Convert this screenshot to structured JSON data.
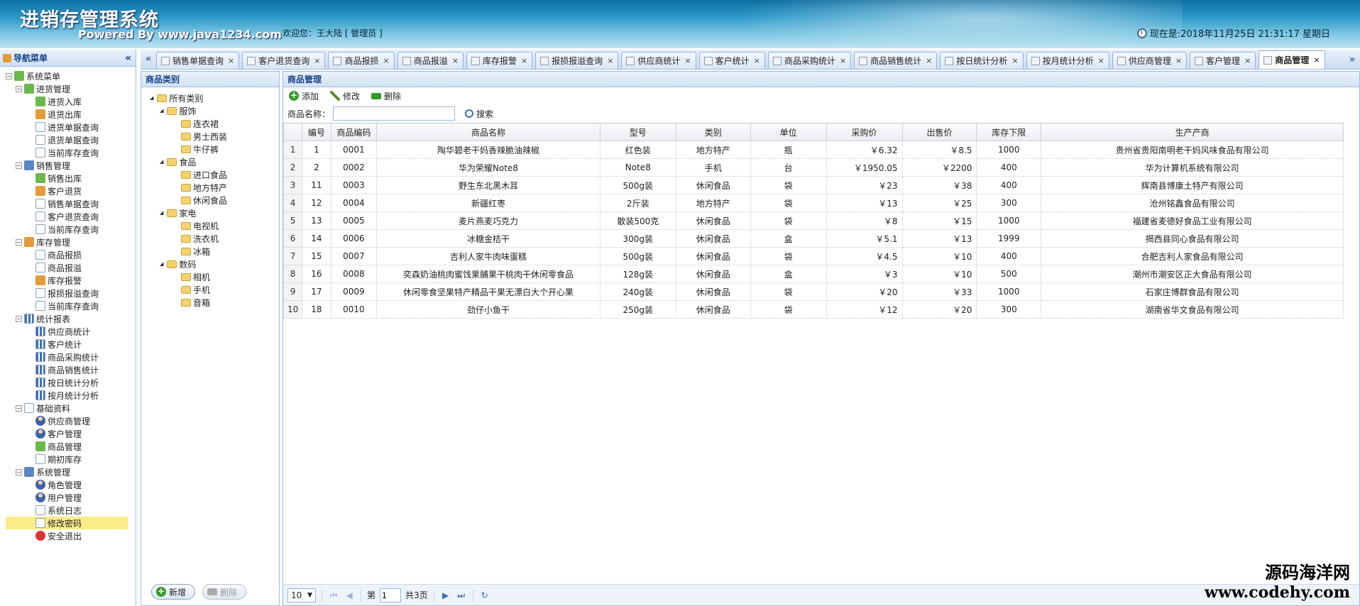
{
  "header": {
    "title": "进销存管理系统",
    "subtitle": "Powered By www.java1234.com",
    "welcome": "欢迎您：王大陆 [ 管理员 ]",
    "clock": "现在是:2018年11月25日 21:31:17 星期日"
  },
  "nav": {
    "title": "导航菜单",
    "root": "系统菜单",
    "groups": [
      {
        "label": "进货管理",
        "items": [
          "进货入库",
          "退货出库",
          "进货单据查询",
          "退货单据查询",
          "当前库存查询"
        ]
      },
      {
        "label": "销售管理",
        "items": [
          "销售出库",
          "客户退货",
          "销售单据查询",
          "客户退货查询",
          "当前库存查询"
        ]
      },
      {
        "label": "库存管理",
        "items": [
          "商品报损",
          "商品报溢",
          "库存报警",
          "报损报溢查询",
          "当前库存查询"
        ]
      },
      {
        "label": "统计报表",
        "items": [
          "供应商统计",
          "客户统计",
          "商品采购统计",
          "商品销售统计",
          "按日统计分析",
          "按月统计分析"
        ]
      },
      {
        "label": "基础资料",
        "items": [
          "供应商管理",
          "客户管理",
          "商品管理",
          "期初库存"
        ]
      },
      {
        "label": "系统管理",
        "items": [
          "角色管理",
          "用户管理",
          "系统日志",
          "修改密码",
          "安全退出"
        ]
      }
    ]
  },
  "tabs": [
    "销售单据查询",
    "客户退货查询",
    "商品报损",
    "商品报溢",
    "库存报警",
    "报损报溢查询",
    "供应商统计",
    "客户统计",
    "商品采购统计",
    "商品销售统计",
    "按日统计分析",
    "按月统计分析",
    "供应商管理",
    "客户管理",
    "商品管理"
  ],
  "category": {
    "title": "商品类别",
    "root": "所有类别",
    "groups": [
      {
        "label": "服饰",
        "items": [
          "连衣裙",
          "男士西装",
          "牛仔裤"
        ]
      },
      {
        "label": "食品",
        "items": [
          "进口食品",
          "地方特产",
          "休闲食品"
        ]
      },
      {
        "label": "家电",
        "items": [
          "电视机",
          "洗衣机",
          "冰箱"
        ]
      },
      {
        "label": "数码",
        "items": [
          "相机",
          "手机",
          "音箱"
        ]
      }
    ],
    "add_label": "新增",
    "delete_label": "删除"
  },
  "main": {
    "title": "商品管理",
    "toolbar": {
      "add": "添加",
      "edit": "修改",
      "delete": "删除"
    },
    "search": {
      "label": "商品名称：",
      "value": "",
      "button": "搜索"
    },
    "columns": [
      "",
      "编号",
      "商品编码",
      "商品名称",
      "型号",
      "类别",
      "单位",
      "采购价",
      "出售价",
      "库存下限",
      "生产产商"
    ],
    "rows": [
      [
        "1",
        "1",
        "0001",
        "陶华碧老干妈香辣脆油辣椒",
        "红色装",
        "地方特产",
        "瓶",
        "￥6.32",
        "￥8.5",
        "1000",
        "贵州省贵阳南明老干妈风味食品有限公司"
      ],
      [
        "2",
        "2",
        "0002",
        "华为荣耀Note8",
        "Note8",
        "手机",
        "台",
        "￥1950.05",
        "￥2200",
        "400",
        "华为计算机系统有限公司"
      ],
      [
        "3",
        "11",
        "0003",
        "野生东北黑木耳",
        "500g装",
        "休闲食品",
        "袋",
        "￥23",
        "￥38",
        "400",
        "辉南县博康土特产有限公司"
      ],
      [
        "4",
        "12",
        "0004",
        "新疆红枣",
        "2斤装",
        "地方特产",
        "袋",
        "￥13",
        "￥25",
        "300",
        "沧州铭鑫食品有限公司"
      ],
      [
        "5",
        "13",
        "0005",
        "麦片燕麦巧克力",
        "散装500克",
        "休闲食品",
        "袋",
        "￥8",
        "￥15",
        "1000",
        "福建省麦德好食品工业有限公司"
      ],
      [
        "6",
        "14",
        "0006",
        "冰糖金桔干",
        "300g装",
        "休闲食品",
        "盒",
        "￥5.1",
        "￥13",
        "1999",
        "揭西县同心食品有限公司"
      ],
      [
        "7",
        "15",
        "0007",
        "吉利人家牛肉味蛋糕",
        "500g装",
        "休闲食品",
        "袋",
        "￥4.5",
        "￥10",
        "400",
        "合肥吉利人家食品有限公司"
      ],
      [
        "8",
        "16",
        "0008",
        "奕森奶油桃肉蜜饯果脯果干桃肉干休闲零食品",
        "128g装",
        "休闲食品",
        "盒",
        "￥3",
        "￥10",
        "500",
        "潮州市潮安区正大食品有限公司"
      ],
      [
        "9",
        "17",
        "0009",
        "休闲零食坚果特产精品干果无漂白大个开心果",
        "240g装",
        "休闲食品",
        "袋",
        "￥20",
        "￥33",
        "1000",
        "石家庄博群食品有限公司"
      ],
      [
        "10",
        "18",
        "0010",
        "劲仔小鱼干",
        "250g装",
        "休闲食品",
        "袋",
        "￥12",
        "￥20",
        "300",
        "湖南省华文食品有限公司"
      ]
    ]
  },
  "pager": {
    "page_size": "10",
    "page_prefix": "第",
    "page_value": "1",
    "page_suffix": "共3页"
  },
  "watermark": {
    "line1": "源码海洋网",
    "line2": "www.codehy.com"
  }
}
